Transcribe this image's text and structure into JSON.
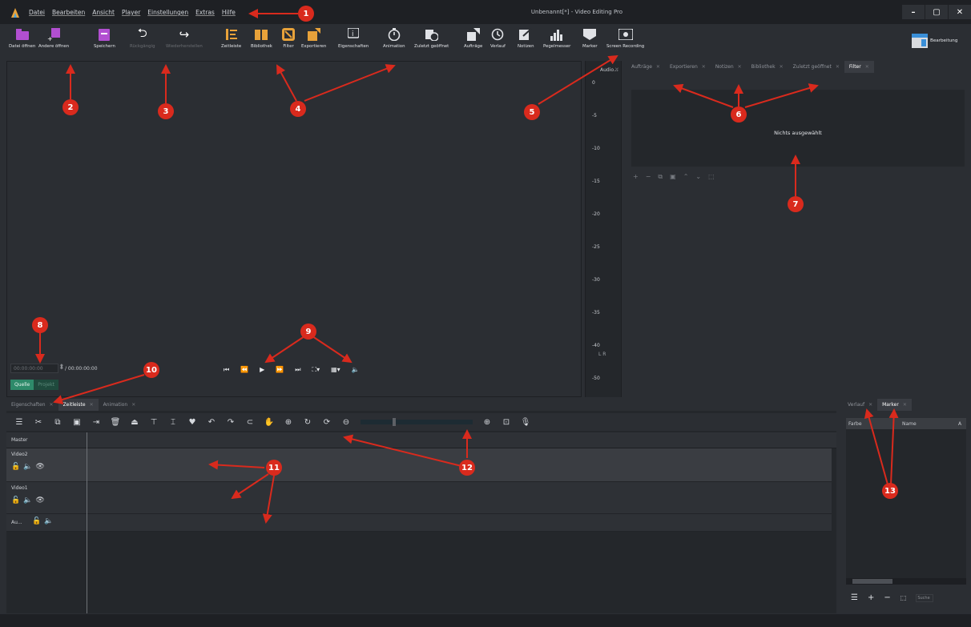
{
  "app": {
    "window_title": "Unbenannt[*] - Video Editing Pro"
  },
  "menu": [
    "Datei",
    "Bearbeiten",
    "Ansicht",
    "Player",
    "Einstellungen",
    "Extras",
    "Hilfe"
  ],
  "window_controls": {
    "minimize": "–",
    "maximize": "▢",
    "close": "✕"
  },
  "toolbar": {
    "open_file": "Datei öffnen",
    "open_other": "Andere öffnen",
    "save": "Speichern",
    "undo": "Rückgängig",
    "redo": "Wiederherstellen",
    "timeline": "Zeitleiste",
    "library": "Bibliothek",
    "filter": "Filter",
    "export": "Exportieren",
    "properties": "Eigenschaften",
    "animation": "Animation",
    "recent": "Zuletzt geöffnet",
    "jobs": "Aufträge",
    "history": "Verlauf",
    "notes": "Notizen",
    "meter": "Pegelmesser",
    "marker": "Marker",
    "screen_recording": "Screen Recording",
    "layout": "Bearbeitung"
  },
  "audio_meter": {
    "title": "Audio...",
    "ticks": [
      "0",
      "-5",
      "-10",
      "-15",
      "-20",
      "-25",
      "-30",
      "-35",
      "-40",
      "-50"
    ],
    "channels": "L R"
  },
  "right_tabs": [
    {
      "label": "Aufträge"
    },
    {
      "label": "Exportieren"
    },
    {
      "label": "Notizen"
    },
    {
      "label": "Bibliothek"
    },
    {
      "label": "Zuletzt geöffnet"
    },
    {
      "label": "Filter",
      "active": true
    }
  ],
  "filter_panel": {
    "empty_text": "Nichts ausgewählt"
  },
  "player": {
    "timecode": "00:00:00:00",
    "duration": "/ 00:00:00:00",
    "source_tab": "Quelle",
    "project_tab": "Projekt"
  },
  "bottom_tabs": [
    {
      "label": "Eigenschaften"
    },
    {
      "label": "Zeitleiste",
      "active": true
    },
    {
      "label": "Animation"
    }
  ],
  "timeline": {
    "master": "Master",
    "tracks": [
      {
        "name": "Video2"
      },
      {
        "name": "Video1"
      },
      {
        "name": "Au..."
      }
    ]
  },
  "marker_panel": {
    "tabs": [
      {
        "label": "Verlauf"
      },
      {
        "label": "Marker",
        "active": true
      }
    ],
    "columns": [
      "Farbe",
      "Name",
      "A"
    ],
    "search_placeholder": "Suche"
  },
  "callouts": [
    "1",
    "2",
    "3",
    "4",
    "5",
    "6",
    "7",
    "8",
    "9",
    "10",
    "11",
    "12",
    "13"
  ],
  "colors": {
    "accent": "#3a8fd8",
    "callout": "#d92a1d",
    "source_tab": "#2e8a6a"
  }
}
